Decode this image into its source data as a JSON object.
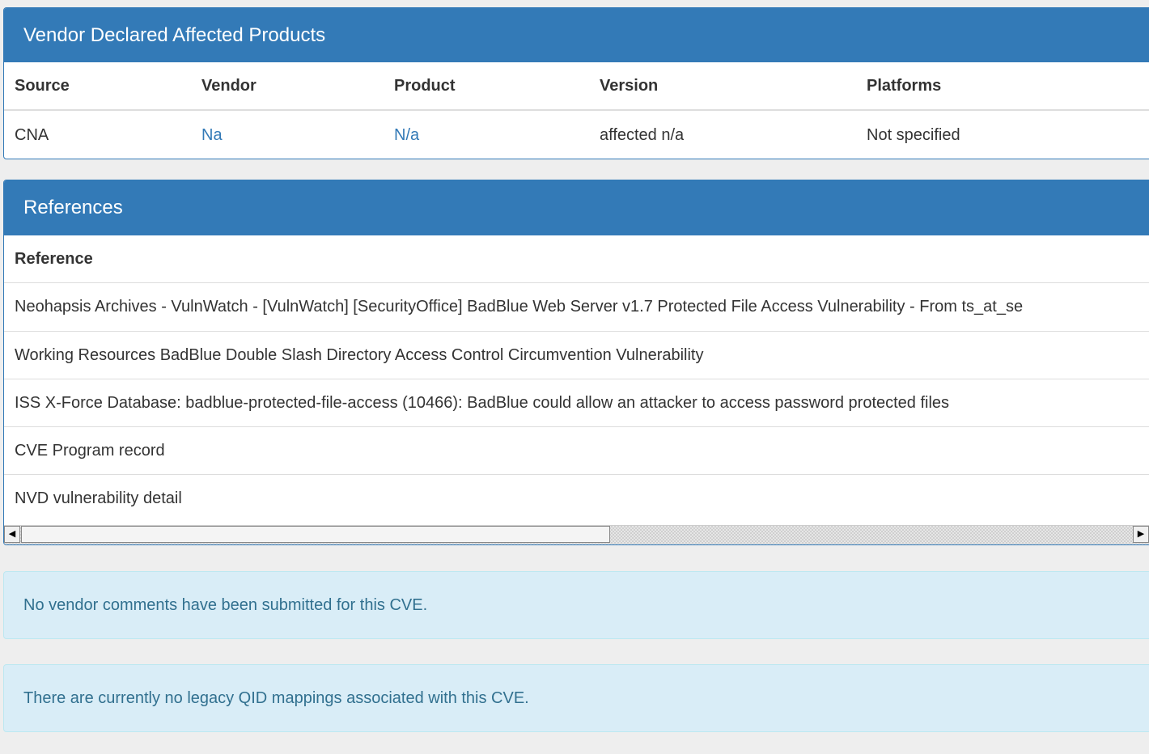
{
  "affected_products": {
    "title": "Vendor Declared Affected Products",
    "columns": [
      "Source",
      "Vendor",
      "Product",
      "Version",
      "Platforms"
    ],
    "rows": [
      {
        "source": "CNA",
        "vendor": "Na",
        "product": "N/a",
        "version": "affected n/a",
        "platforms": "Not specified"
      }
    ]
  },
  "references": {
    "title": "References",
    "column": "Reference",
    "items": [
      "Neohapsis Archives - VulnWatch - [VulnWatch] [SecurityOffice] BadBlue Web Server v1.7 Protected File Access Vulnerability - From ts_at_se",
      "Working Resources BadBlue Double Slash Directory Access Control Circumvention Vulnerability",
      "ISS X-Force Database: badblue-protected-file-access (10466): BadBlue could allow an attacker to access password protected files",
      "CVE Program record",
      "NVD vulnerability detail"
    ]
  },
  "scrollbar": {
    "left_arrow": "◀",
    "right_arrow": "▶"
  },
  "alerts": {
    "vendor_comments": "No vendor comments have been submitted for this CVE.",
    "qid_mappings": "There are currently no legacy QID mappings associated with this CVE."
  },
  "colors": {
    "panel_heading": "#337ab7",
    "link": "#337ab7",
    "alert_bg": "#d9edf7",
    "alert_text": "#31708f",
    "page_bg": "#eeeeee"
  }
}
